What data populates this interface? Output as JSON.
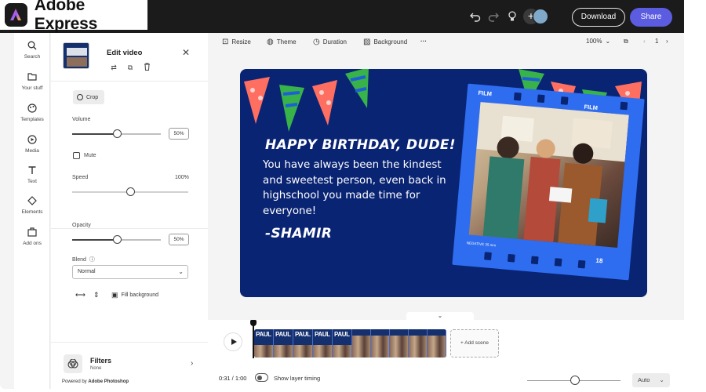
{
  "app": {
    "name": "Adobe Express"
  },
  "topbar": {
    "download_label": "Download",
    "share_label": "Share",
    "icons": [
      "undo-icon",
      "redo-icon",
      "lightbulb-icon",
      "add-collaborator-icon"
    ],
    "accent_color": "#5c5ce0"
  },
  "rail": {
    "items": [
      {
        "label": "Search",
        "icon": "search-icon"
      },
      {
        "label": "Your stuff",
        "icon": "folder-icon"
      },
      {
        "label": "Templates",
        "icon": "templates-icon"
      },
      {
        "label": "Media",
        "icon": "media-icon"
      },
      {
        "label": "Text",
        "icon": "text-icon"
      },
      {
        "label": "Elements",
        "icon": "elements-icon"
      },
      {
        "label": "Add ons",
        "icon": "addons-icon"
      }
    ]
  },
  "panel": {
    "title": "Edit video",
    "crop_label": "Crop",
    "volume": {
      "label": "Volume",
      "value": "50%",
      "level": 0.5
    },
    "mute_label": "Mute",
    "speed": {
      "label": "Speed",
      "value": "100%",
      "level": 0.5
    },
    "opacity": {
      "label": "Opacity",
      "value": "50%",
      "level": 0.5
    },
    "blend": {
      "label": "Blend",
      "value": "Normal"
    },
    "fill_background_label": "Fill background",
    "filters": {
      "title": "Filters",
      "value": "None"
    },
    "powered_by": "Powered by ",
    "powered_by_brand": "Adobe Photoshop"
  },
  "canvas_toolbar": {
    "resize": "Resize",
    "theme": "Theme",
    "duration": "Duration",
    "background": "Background",
    "zoom": "100%",
    "page": "1"
  },
  "card": {
    "heading": "HAPPY BIRTHDAY, DUDE!",
    "body": "You have always been the kindest and sweetest person, even back in highschool you made time for everyone!",
    "signature": "-SHAMIR",
    "frame_label_1": "FILM",
    "frame_label_2": "FILM",
    "frame_number": "18",
    "frame_caption": "NEGATIVE 35 mm",
    "background_color": "#0a2474",
    "frame_color": "#2f6df0"
  },
  "timeline": {
    "clip_labels": [
      "PAUL",
      "PAUL",
      "PAUL",
      "PAUL",
      "PAUL"
    ],
    "add_scene_label": "+ Add scene",
    "time": "0:31 / 1:00",
    "show_layer_timing_label": "Show layer timing",
    "auto_label": "Auto"
  }
}
